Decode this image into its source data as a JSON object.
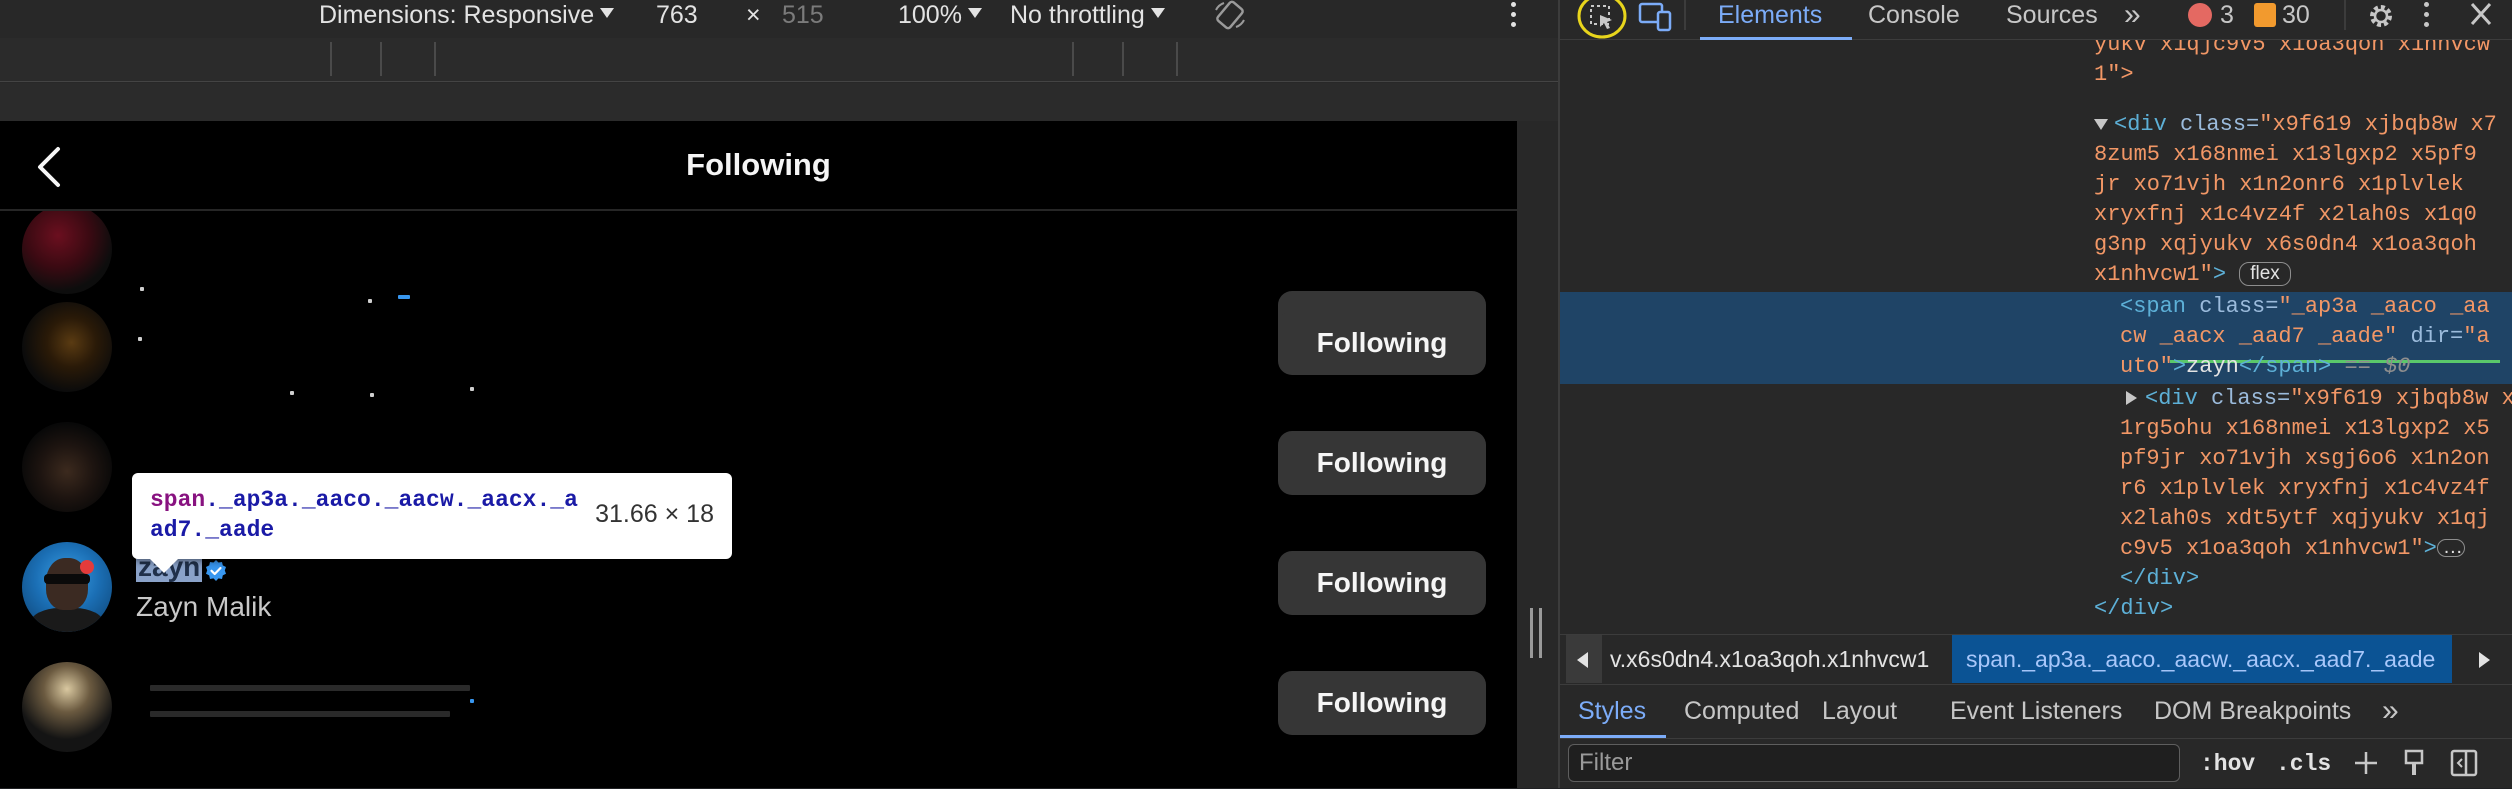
{
  "device_toolbar": {
    "dimensions_label": "Dimensions: Responsive",
    "width": "763",
    "times": "×",
    "height": "515",
    "zoom": "100%",
    "throttling": "No throttling"
  },
  "page": {
    "title": "Following",
    "follow_label": "Following",
    "user": {
      "username": "zayn",
      "full_name": "Zayn Malik"
    }
  },
  "inspector_tooltip": {
    "selector_tag": "span",
    "selector_classes": "._ap3a._aaco._aacw._aacx._aad7._aade",
    "size": "31.66 × 18"
  },
  "devtools": {
    "tabs": [
      "Elements",
      "Console",
      "Sources"
    ],
    "more_tabs": "»",
    "error_count": "3",
    "warning_count": "30",
    "dom_lines": [
      "yukv x1qjc9v5 x1oa3qoh x1nhvcw",
      "1\">",
      "x9f619 xjbqb8w x7",
      "8zum5 x168nmei x13lgxp2 x5pf9",
      "jr xo71vjh x1n2onr6 x1plvlek",
      "xryxfnj x1c4vz4f x2lah0s x1q0",
      "g3np xqjyukv x6s0dn4 x1oa3qoh",
      "x1nhvcw1",
      "_ap3a _aaco _aa",
      "cw _aacx _aad7 _aade",
      "a",
      "uto",
      "zayn",
      "== $0",
      "x9f619 xjbqb8w x",
      "1rg5ohu x168nmei x13lgxp2 x5",
      "pf9jr xo71vjh xsgj6o6 x1n2on",
      "r6 x1plvlek xryxfnj x1c4vz4f",
      "x2lah0s xdt5ytf xqjyukv x1qj",
      "c9v5 x1oa3qoh x1nhvcw1",
      "</div>",
      "</div>"
    ],
    "flex_badge": "flex",
    "breadcrumbs": [
      "v.x6s0dn4.x1oa3qoh.x1nhvcw1",
      "span._ap3a._aaco._aacw._aacx._aad7._aade"
    ],
    "subtabs": [
      "Styles",
      "Computed",
      "Layout",
      "Event Listeners",
      "DOM Breakpoints"
    ],
    "filter_placeholder": "Filter",
    "hov_label": ":hov",
    "cls_label": ".cls"
  },
  "colors": {
    "accent": "#7cacf8",
    "selected_row": "#1f4466",
    "inspect_highlight": "#e8d51c",
    "button_bg": "#363636"
  }
}
